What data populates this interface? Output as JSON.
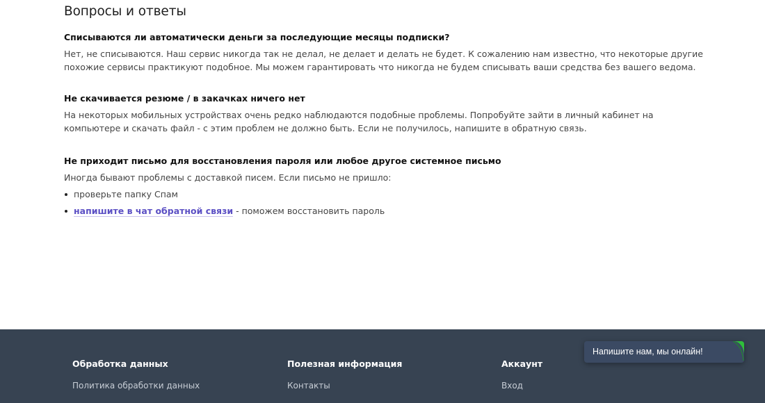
{
  "page": {
    "title": "Вопросы и ответы"
  },
  "faq": [
    {
      "question": "Списываются ли автоматически деньги за последующие месяцы подписки?",
      "answer": "Нет, не списываются. Наш сервис никогда так не делал, не делает и делать не будет. К сожалению нам известно, что некоторые другие похожие сервисы практикуют подобное. Мы можем гарантировать что никогда не будем списывать ваши средства без вашего ведома."
    },
    {
      "question": "Не скачивается резюме / в закачках ничего нет",
      "answer": "На некоторых мобильных устройствах очень редко наблюдаются подобные проблемы. Попробуйте зайти в личный кабинет на компьютере и скачать файл - с этим проблем не должно быть. Если не получилось, напишите в обратную связь."
    },
    {
      "question": "Не приходит письмо для восстановления пароля или любое другое системное письмо",
      "answer": "Иногда бывают проблемы с доставкой писем. Если письмо не пришло:",
      "list": {
        "item1": "проверьте папку Спам",
        "item2_link": "напишите в чат обратной связи",
        "item2_rest": " - поможем восстановить пароль"
      }
    }
  ],
  "footer": {
    "col1": {
      "heading": "Обработка данных",
      "link1": "Политика обработки данных"
    },
    "col2": {
      "heading": "Полезная информация",
      "link1": "Контакты"
    },
    "col3": {
      "heading": "Аккаунт",
      "link1": "Вход"
    }
  },
  "chat": {
    "label": "Напишите нам, мы онлайн!",
    "accent": "#2fbf3a"
  },
  "colors": {
    "footer_bg": "#374352",
    "link": "#5b4fc4"
  }
}
